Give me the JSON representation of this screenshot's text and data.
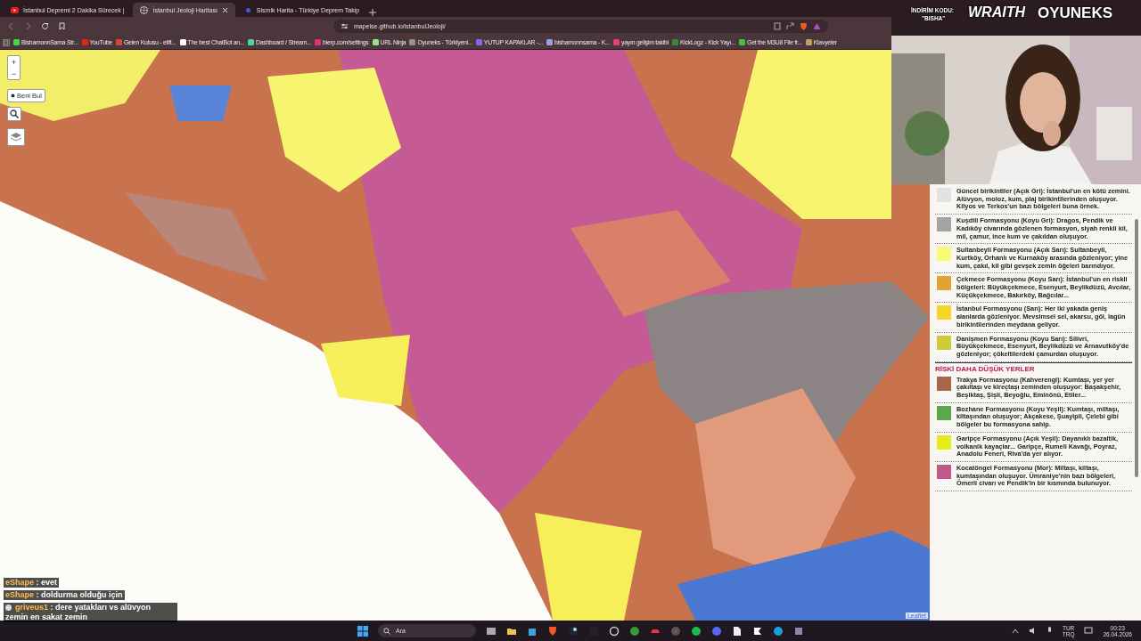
{
  "tabs": [
    {
      "title": "İstanbul Depremi 2 Dakika Sürecek |",
      "selected": false
    },
    {
      "title": "İstanbul Jeoloji Haritası",
      "selected": true
    },
    {
      "title": "Sismik Harita - Türkiye Deprem Takip",
      "selected": false
    }
  ],
  "address": {
    "url": "mapelse.github.io/istanbulJeoloji/"
  },
  "bookmarks": [
    {
      "label": "BishamonnSama Str...",
      "color": "#3fd84a"
    },
    {
      "label": "YouTube",
      "color": "#e62117"
    },
    {
      "label": "Gelen Kutusu - elift...",
      "color": "#d44638"
    },
    {
      "label": "The best ChatBot an...",
      "color": "#ffffff"
    },
    {
      "label": "Dashboard / Stream...",
      "color": "#4fd1a0"
    },
    {
      "label": "bierp.com/settings",
      "color": "#e0307a"
    },
    {
      "label": "URL Ninja",
      "color": "#9be08a"
    },
    {
      "label": "Oyuneks - Türkiyeni...",
      "color": "#8a9a7a"
    },
    {
      "label": "YUTUP KAPAKLAR -...",
      "color": "#7a6cf0"
    },
    {
      "label": "bishamonnsama - K...",
      "color": "#9aa0e8"
    },
    {
      "label": "yayın gelişim takibi",
      "color": "#e8407a"
    },
    {
      "label": "KickLogz - Kick Yayı...",
      "color": "#3a8a3a"
    },
    {
      "label": "Get the M3U8 File fr...",
      "color": "#40c040"
    },
    {
      "label": "Klavyeler",
      "color": "#c0a060"
    }
  ],
  "stream_overlay": {
    "promo_label": "İNDİRİM KODU:",
    "promo_code": "\"BISHA\"",
    "sponsor": "WRAITH",
    "brand": "OYUNEKS"
  },
  "map": {
    "locate_button": "Beni Bul",
    "zoom_in": "+",
    "zoom_out": "−",
    "attribution": "Leaflet"
  },
  "legend": {
    "items": [
      {
        "kind": "formation",
        "color": "#e2e2e2",
        "text": "Güncel birikintiler (Açık Gri): İstanbul'un en kötü zemini. Alüvyon, moloz, kum, plaj birikintilerinden oluşuyor. Kilyos ve Terkos'un bazı bölgeleri buna örnek."
      },
      {
        "kind": "formation",
        "color": "#a3a3a3",
        "text": "Kuşdili Formasyonu (Koyu Gri): Dragos, Pendik ve Kadıköy civarında gözlenen formasyon, siyah renkli kil, mil, çamur, ince kum ve çakıldan oluşuyor."
      },
      {
        "kind": "formation",
        "color": "#faf875",
        "text": "Sultanbeyli Formasyonu (Açık Sarı): Sultanbeyli, Kurtköy, Orhanlı ve Kurnaköy arasında gözleniyor; yine kum, çakıl, kil gibi gevşek zemin öğeleri barındıyor."
      },
      {
        "kind": "formation",
        "color": "#dfa435",
        "text": "Çekmece Formasyonu (Koyu Sarı): İstanbul'un en riskli bölgeleri: Büyükçekmece, Esenyurt, Beylikdüzü, Avcılar, Küçükçekmece, Bakırköy, Bağcılar..."
      },
      {
        "kind": "formation",
        "color": "#f6d52a",
        "text": "İstanbul Formasyonu (Sarı): Her iki yakada geniş alanlarda gözleniyor. Mevsimsel sel, akarsu, göl, lagün birikintilerinden meydana geliyor."
      },
      {
        "kind": "formation",
        "color": "#cdca3c",
        "text": "Danişmen Formasyonu (Koyu Sarı): Silivri, Büyükçekmece, Esenyurt, Beylikdüzü ve Arnavutköy'de gözleniyor; çökeltilerdeki çamurdan oluşuyor."
      },
      {
        "kind": "heading",
        "text": "RİSKİ DAHA DÜŞÜK YERLER"
      },
      {
        "kind": "formation",
        "color": "#a8674a",
        "text": "Trakya Formasyonu (Kahverengi): Kumtaşı, yer yer çakıltaşı ve kireçtaşı zeminden oluşuyor: Başakşehir, Beşiktaş, Şişli, Beyoğlu, Eminönü, Etiler..."
      },
      {
        "kind": "formation",
        "color": "#5ea64e",
        "text": "Bozhane Formasyonu (Koyu Yeşil): Kumtaşı, miltaşı, kiltaşından oluşuyor; Akçakese, Şuayipli, Çelebi gibi bölgeler bu formasyona sahip."
      },
      {
        "kind": "formation",
        "color": "#e5ec1c",
        "text": "Garipçe Formasyonu (Açık Yeşil): Dayanıklı bazaltik, volkanik kayaçlar... Garipçe, Rumeli Kavağı, Poyraz, Anadolu Feneri, Riva'da yer alıyor."
      },
      {
        "kind": "formation",
        "color": "#c4578a",
        "text": "Kocatöngel Formasyonu (Mor): Miltaşı, kiltaşı, kumtaşından oluşuyor. Ümraniye'nin bazı bölgeleri, Ömerli civarı ve Pendik'in bir kısmında bulunuyor."
      }
    ]
  },
  "chat": [
    {
      "user": "eShape",
      "text": ": evet"
    },
    {
      "user": "eShape",
      "text": ": doldurma olduğu için"
    },
    {
      "user": "griveus1",
      "text": ": dere yatakları vs alüvyon zemin en sakat zemin",
      "badge": true
    }
  ],
  "taskbar": {
    "search_placeholder": "Ara",
    "language": "TUR",
    "layout": "TRQ",
    "time": "00:23",
    "date": "26.04.2026"
  }
}
